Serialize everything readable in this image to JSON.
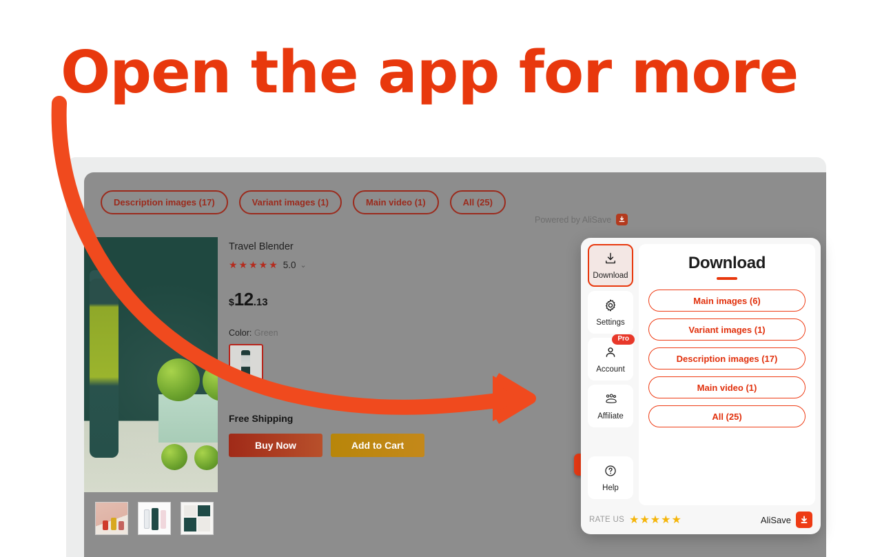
{
  "headline": "Open the app for more",
  "colors": {
    "brand_red": "#E8380D",
    "chip_red": "#9b2a1c",
    "star_gold": "#f5b50a",
    "buy_now": "#a02a18",
    "add_to_cart": "#b8860a"
  },
  "page": {
    "chips": [
      {
        "label": "Description images (17)"
      },
      {
        "label": "Variant images (1)"
      },
      {
        "label": "Main video (1)"
      },
      {
        "label": "All (25)"
      }
    ],
    "powered_by": "Powered by AliSave",
    "product": {
      "title": "Travel Blender",
      "stars": "★★★★★",
      "rating": "5.0",
      "caret": "⌄",
      "price_currency": "$",
      "price_main": "12",
      "price_cents": ".13",
      "color_label": "Color:",
      "color_value": "Green",
      "shipping": "Free Shipping",
      "buy_now_label": "Buy Now",
      "add_to_cart_label": "Add to Cart"
    }
  },
  "panel": {
    "title": "Download",
    "nav": [
      {
        "label": "Download",
        "icon": "download-icon",
        "active": true
      },
      {
        "label": "Settings",
        "icon": "gear-icon",
        "active": false
      },
      {
        "label": "Account",
        "icon": "user-icon",
        "active": false,
        "badge": "Pro"
      },
      {
        "label": "Affiliate",
        "icon": "people-group-icon",
        "active": false
      },
      {
        "label": "Help",
        "icon": "question-circle-icon",
        "active": false
      }
    ],
    "download_buttons": [
      {
        "label": "Main images (6)"
      },
      {
        "label": "Variant images (1)"
      },
      {
        "label": "Description images (17)"
      },
      {
        "label": "Main video (1)"
      },
      {
        "label": "All (25)"
      }
    ],
    "footer": {
      "rate_us_label": "RATE US",
      "rate_stars": "★★★★★",
      "brand": "AliSave"
    }
  }
}
